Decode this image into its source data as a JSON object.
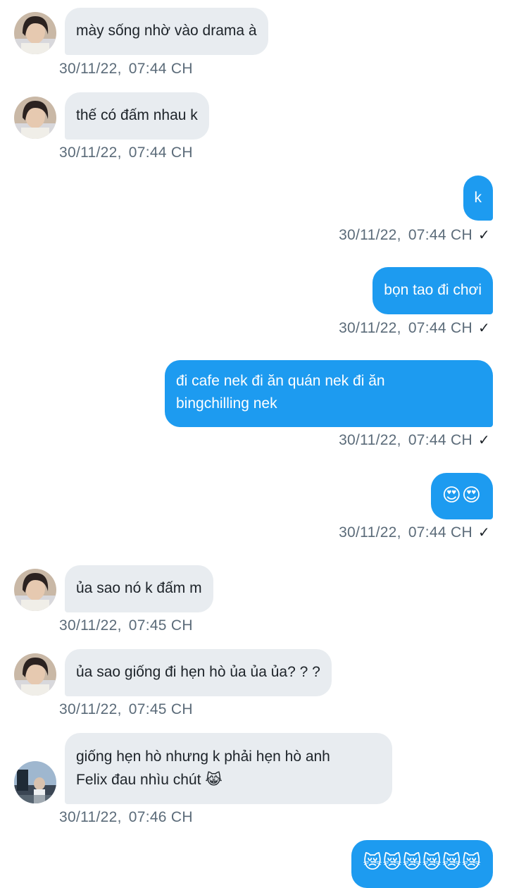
{
  "messages": [
    {
      "side": "in",
      "avatar": "avatar-a",
      "text": "mày sống nhờ vào drama à",
      "time": "30/11/22,",
      "clock": "07:44 CH"
    },
    {
      "side": "in",
      "avatar": "avatar-a",
      "text": "thế có đấm nhau k",
      "time": "30/11/22,",
      "clock": "07:44 CH"
    },
    {
      "side": "out",
      "text": "k",
      "time": "30/11/22,",
      "clock": "07:44 CH"
    },
    {
      "side": "out",
      "text": "bọn tao đi chơi",
      "time": "30/11/22,",
      "clock": "07:44 CH"
    },
    {
      "side": "out",
      "line1": "đi cafe nek đi ăn quán nek đi ăn",
      "line2": "bingchilling nek",
      "time": "30/11/22,",
      "clock": "07:44 CH"
    },
    {
      "side": "out",
      "emoji": "😍😍",
      "time": "30/11/22,",
      "clock": "07:44 CH"
    },
    {
      "side": "in",
      "avatar": "avatar-a",
      "text": "ủa sao nó k đấm m",
      "time": "30/11/22,",
      "clock": "07:45 CH"
    },
    {
      "side": "in",
      "avatar": "avatar-a",
      "text": "ủa sao giống đi hẹn hò ủa ủa ủa? ? ?",
      "time": "30/11/22,",
      "clock": "07:45 CH"
    },
    {
      "side": "in",
      "avatar": "avatar-b",
      "line1": "giống hẹn hò nhưng k phải hẹn hò anh",
      "line2": "Felix đau nhìu chút",
      "emoji": "😹",
      "time": "30/11/22,",
      "clock": "07:46 CH"
    },
    {
      "side": "out",
      "emoji": "😿😿😿😿😿😿"
    }
  ],
  "read_mark": "✓",
  "colors": {
    "outgoing_bubble": "#1d9bf0",
    "incoming_bubble": "#e8ecf0",
    "timestamp": "#5b6b79"
  }
}
